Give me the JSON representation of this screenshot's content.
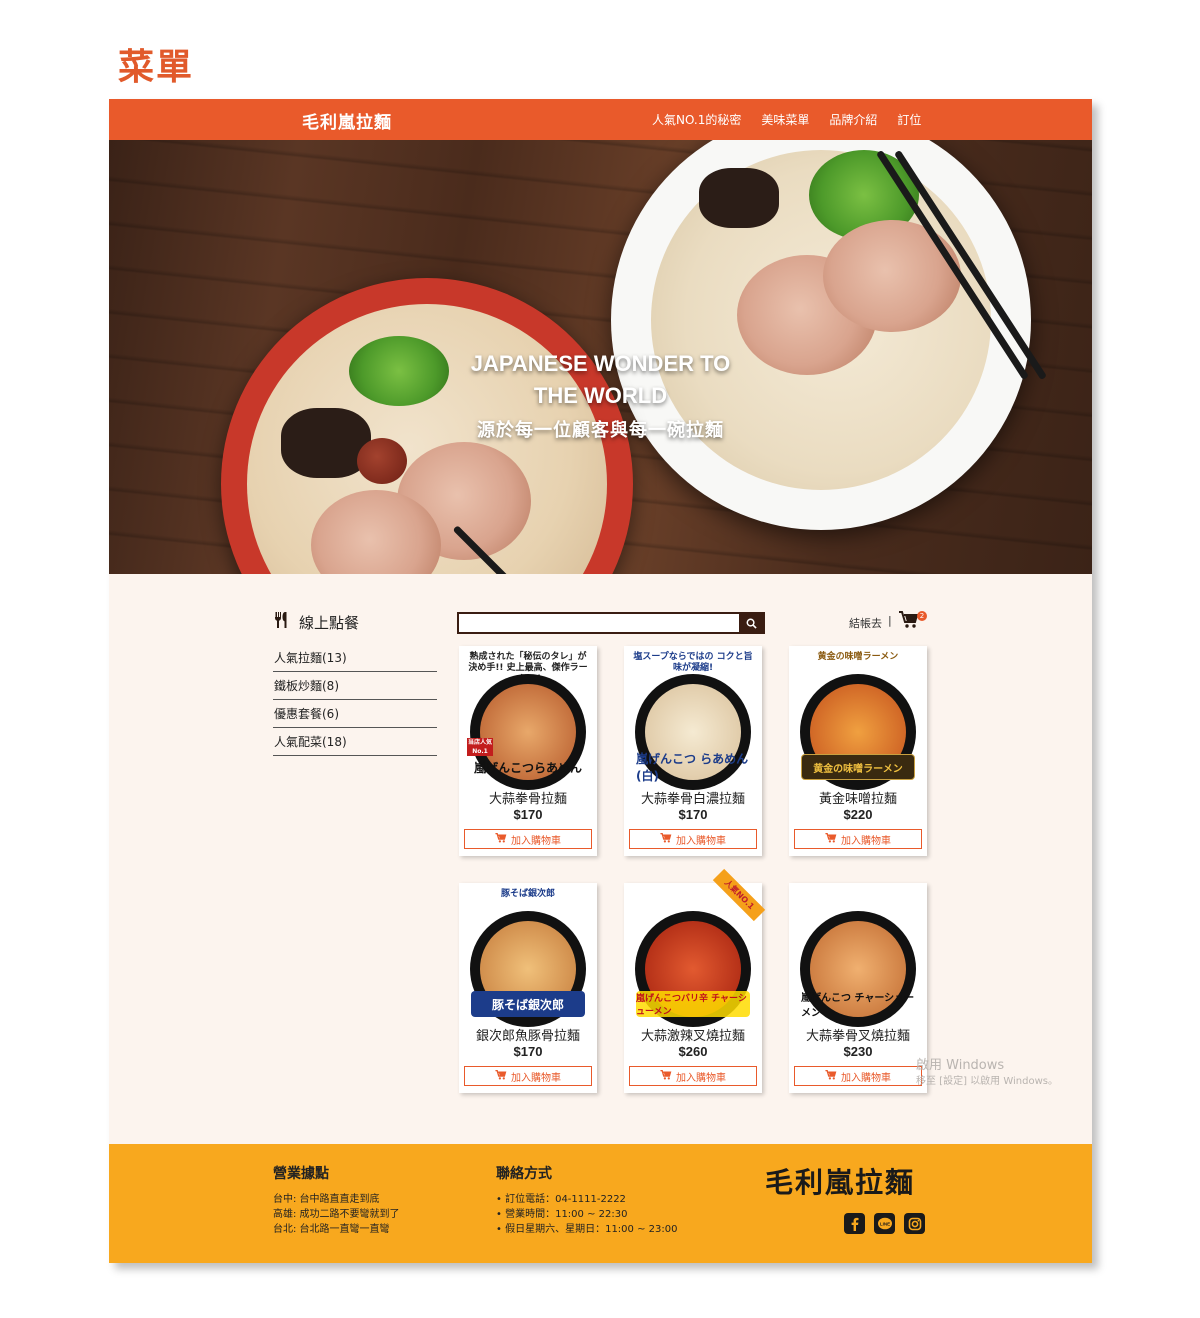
{
  "page_label": "菜單",
  "header": {
    "brand": "毛利嵐拉麵",
    "nav": [
      "人氣NO.1的秘密",
      "美味菜單",
      "品牌介紹",
      "訂位"
    ]
  },
  "hero": {
    "en_title": "JAPANESE WONDER TO THE WORLD",
    "zh_subtitle": "源於每一位顧客與每一碗拉麵"
  },
  "sidebar": {
    "title": "線上點餐",
    "categories": [
      "人氣拉麵(13)",
      "鐵板炒麵(8)",
      "優惠套餐(6)",
      "人氣配菜(18)"
    ]
  },
  "search": {
    "placeholder": "",
    "value": ""
  },
  "cart": {
    "checkout_label": "結帳去",
    "separator": "|",
    "count": "2"
  },
  "products": [
    {
      "name": "大蒜拳骨拉麵",
      "price": "$170",
      "button": "加入購物車",
      "cap": "熟成された「秘伝のタレ」が決め手!! 史上最高、傑作ラーメン!!",
      "logo": "嵐げんこつらあめん",
      "badge": "当店人気 No.1",
      "ribbon": ""
    },
    {
      "name": "大蒜拳骨白濃拉麵",
      "price": "$170",
      "button": "加入購物車",
      "cap": "塩スープならではの コクと旨味が凝縮!",
      "logo": "嵐げんこつ らあめん(白)",
      "badge": "",
      "ribbon": ""
    },
    {
      "name": "黃金味噌拉麵",
      "price": "$220",
      "button": "加入購物車",
      "cap": "黄金の味噌ラーメン",
      "logo": "黄金の味噌ラーメン",
      "badge": "",
      "ribbon": ""
    },
    {
      "name": "銀次郎魚豚骨拉麵",
      "price": "$170",
      "button": "加入購物車",
      "cap": "豚そば銀次郎",
      "logo": "豚そば銀次郎",
      "badge": "",
      "ribbon": ""
    },
    {
      "name": "大蒜激辣叉燒拉麵",
      "price": "$260",
      "button": "加入購物車",
      "cap": "",
      "logo": "嵐げんこつバリ辛 チャーシューメン",
      "badge": "",
      "ribbon": "人氣NO.1"
    },
    {
      "name": "大蒜拳骨叉燒拉麵",
      "price": "$230",
      "button": "加入購物車",
      "cap": "",
      "logo": "嵐げんこつ チャーシューメン",
      "badge": "",
      "ribbon": ""
    }
  ],
  "watermark": {
    "line1": "啟用 Windows",
    "line2": "移至 [設定] 以啟用 Windows。"
  },
  "footer": {
    "locations_title": "營業據點",
    "locations": [
      "台中: 台中路直直走到底",
      "高雄: 成功二路不要彎就到了",
      "台北: 台北路一直彎一直彎"
    ],
    "contact_title": "聯絡方式",
    "contact": [
      "• 訂位電話：04-1111-2222",
      "• 營業時間：11:00 ~ 22:30",
      "• 假日星期六、星期日：11:00 ~ 23:00"
    ],
    "brand": "毛利嵐拉麵",
    "social": [
      "facebook-icon",
      "line-icon",
      "instagram-icon"
    ]
  },
  "colors": {
    "accent": "#e95a2b",
    "footer": "#f8a81e",
    "background": "#fcf4ee",
    "dark": "#3a1d12"
  }
}
